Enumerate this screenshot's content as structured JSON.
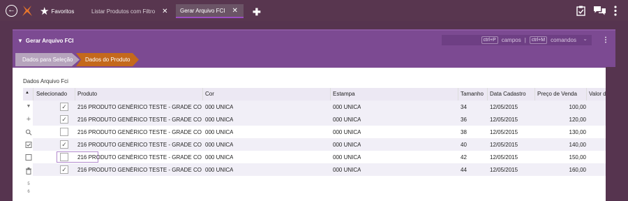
{
  "topbar": {
    "favorites_label": "Favoritos",
    "tabs": [
      {
        "label": "Listar Produtos com Filtro",
        "close": "✕"
      },
      {
        "label": "Gerar Arquivo FCI",
        "close": "✕"
      }
    ],
    "add_tab": "✚",
    "icons": [
      "back-icon",
      "logo-icon",
      "star-icon",
      "clipboard-check-icon",
      "chat-icon",
      "kebab-menu-icon"
    ]
  },
  "panel": {
    "title": "Gerar Arquivo FCI",
    "shortcut_fields_key": "ctrl+P",
    "shortcut_fields_label": "campos",
    "separator": "|",
    "shortcut_commands_key": "ctrl+M",
    "shortcut_commands_label": "comandos",
    "steps": [
      "Dados para Seleção",
      "Dados do Produto"
    ]
  },
  "grid": {
    "section_label": "Dados Arquivo Fci",
    "sort_indicator": "▲",
    "columns": [
      "Selecionado",
      "Produto",
      "Cor",
      "Estampa",
      "Tamanho",
      "Data Cadastro",
      "Preço de Venda",
      "Valor d"
    ],
    "rows": [
      {
        "selected": true,
        "produto": "216 PRODUTO GENÉRICO TESTE - GRADE CO...",
        "cor": "000 UNICA",
        "estampa": "000 UNICA",
        "tamanho": "34",
        "data": "12/05/2015",
        "preco": "100,00"
      },
      {
        "selected": true,
        "produto": "216 PRODUTO GENÉRICO TESTE - GRADE CO...",
        "cor": "000 UNICA",
        "estampa": "000 UNICA",
        "tamanho": "36",
        "data": "12/05/2015",
        "preco": "120,00"
      },
      {
        "selected": false,
        "produto": "216 PRODUTO GENÉRICO TESTE - GRADE CO...",
        "cor": "000 UNICA",
        "estampa": "000 UNICA",
        "tamanho": "38",
        "data": "12/05/2015",
        "preco": "130,00"
      },
      {
        "selected": true,
        "produto": "216 PRODUTO GENÉRICO TESTE - GRADE CO...",
        "cor": "000 UNICA",
        "estampa": "000 UNICA",
        "tamanho": "40",
        "data": "12/05/2015",
        "preco": "140,00"
      },
      {
        "selected": false,
        "produto": "216 PRODUTO GENÉRICO TESTE - GRADE CO...",
        "cor": "000 UNICA",
        "estampa": "000 UNICA",
        "tamanho": "42",
        "data": "12/05/2015",
        "preco": "150,00"
      },
      {
        "selected": true,
        "produto": "216 PRODUTO GENÉRICO TESTE - GRADE CO...",
        "cor": "000 UNICA",
        "estampa": "000 UNICA",
        "tamanho": "44",
        "data": "12/05/2015",
        "preco": "160,00"
      }
    ],
    "side_toolbar": [
      "chevron-down-icon",
      "plus-icon",
      "search-icon",
      "check-square-icon",
      "square-icon",
      "trash-icon"
    ],
    "side_numbers": [
      "5",
      "6"
    ]
  },
  "colors": {
    "topbar": "#58364f",
    "panel_header": "#7c4a92",
    "active_step": "#c4691c",
    "inactive_step": "#b6a4bd",
    "row_alt": "#f1eff7"
  }
}
